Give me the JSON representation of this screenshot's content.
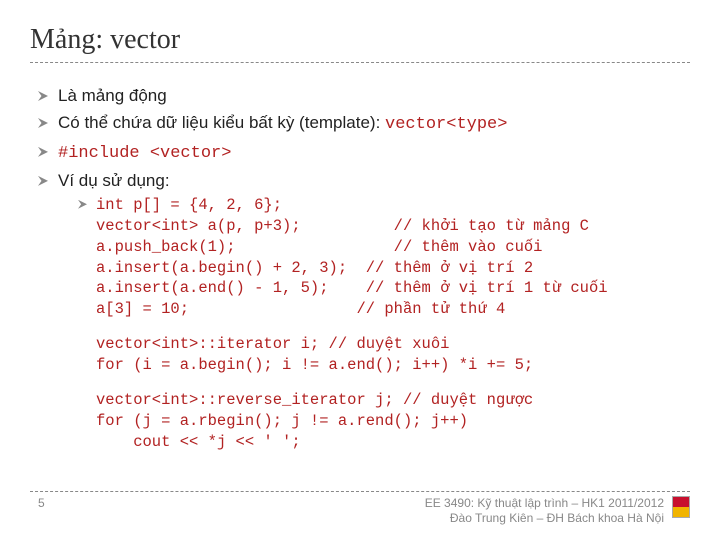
{
  "title": "Mảng: vector",
  "items": {
    "i0": "Là mảng động",
    "i1_prefix": "Có thể chứa dữ liệu kiểu bất kỳ (template): ",
    "i1_code": "vector<type>",
    "i2": "#include <vector>",
    "i3": "Ví dụ sử dụng:"
  },
  "code": {
    "block1": "int p[] = {4, 2, 6};\nvector<int> a(p, p+3);          // khởi tạo từ mảng C\na.push_back(1);                 // thêm vào cuối\na.insert(a.begin() + 2, 3);  // thêm ở vị trí 2\na.insert(a.end() - 1, 5);    // thêm ở vị trí 1 từ cuối\na[3] = 10;                  // phần tử thứ 4",
    "block2": "vector<int>::iterator i; // duyệt xuôi\nfor (i = a.begin(); i != a.end(); i++) *i += 5;",
    "block3": "vector<int>::reverse_iterator j; // duyệt ngược\nfor (j = a.rbegin(); j != a.rend(); j++)\n    cout << *j << ' ';"
  },
  "footer": {
    "page": "5",
    "line1": "EE 3490: Kỹ thuật lập trình – HK1 2011/2012",
    "line2": "Đào Trung Kiên – ĐH Bách khoa Hà Nội"
  }
}
